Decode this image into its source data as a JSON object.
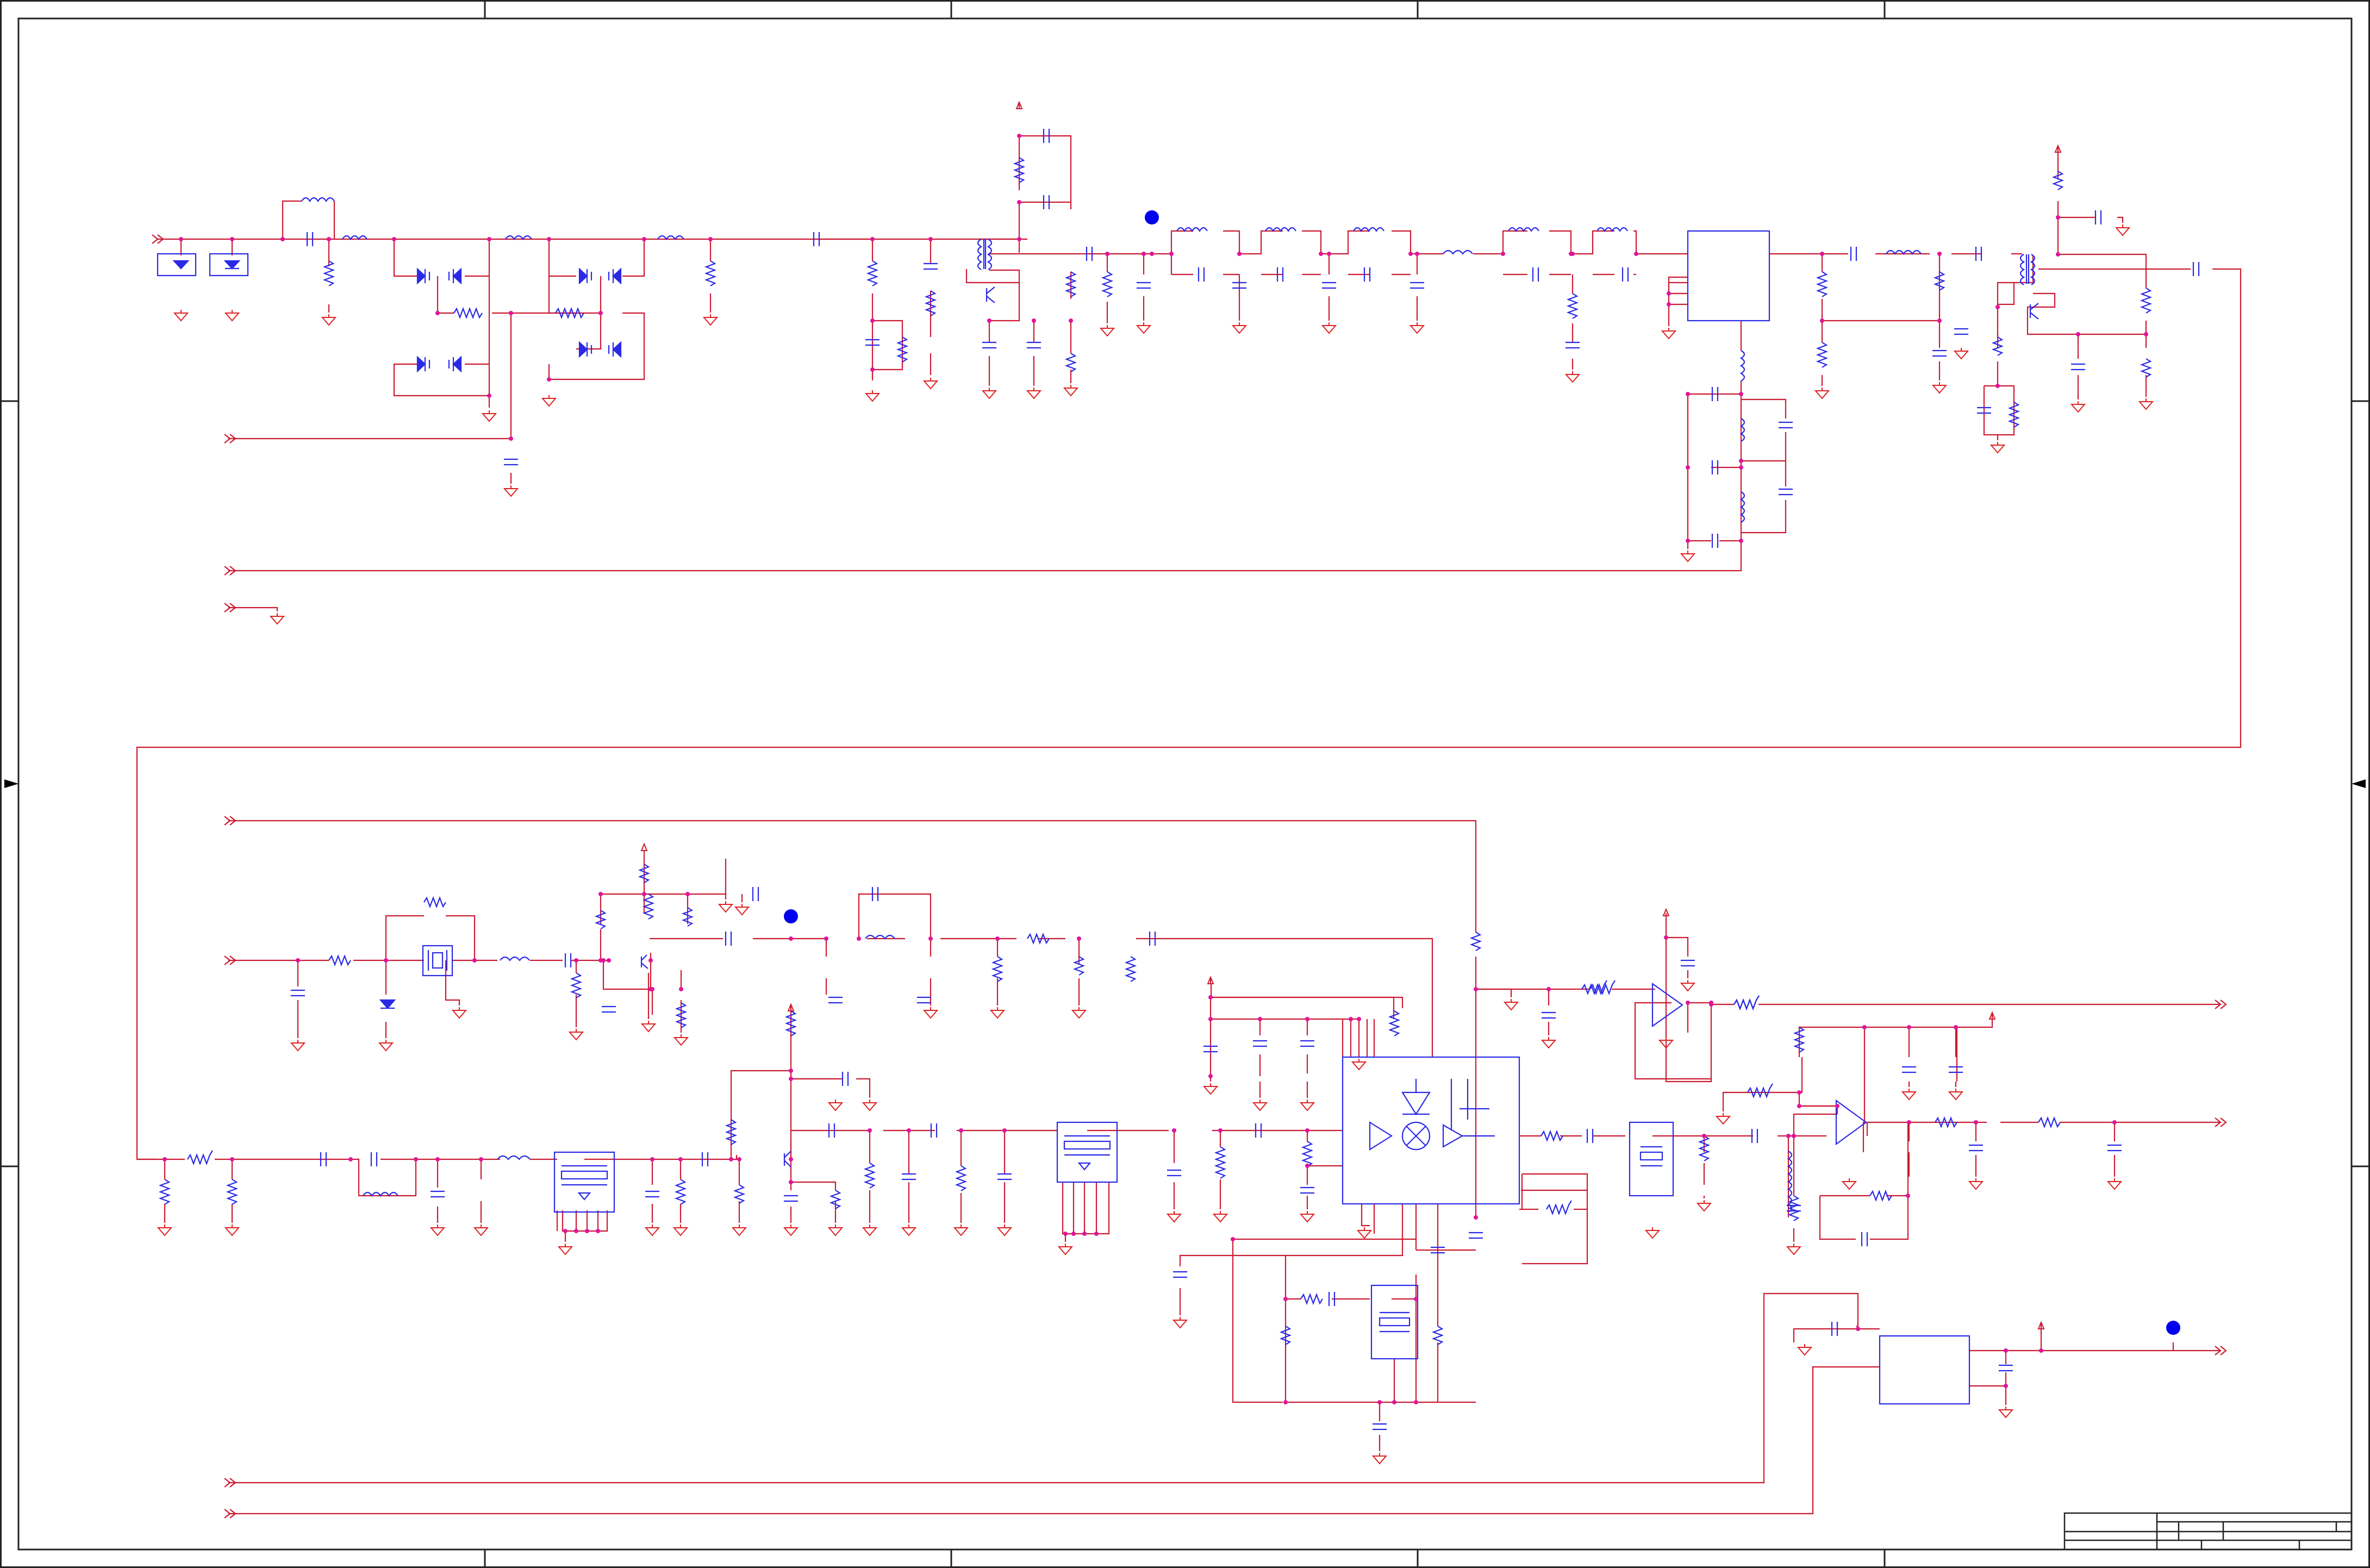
{
  "sheet": {
    "colors": {
      "wire": "#cc1b32",
      "component": "#2a2ae6",
      "frame": "#222222",
      "ground": "#e02020",
      "junction": "#e0159b",
      "testpoint": "#0000ee"
    },
    "title_block": {
      "visible_text": []
    }
  }
}
